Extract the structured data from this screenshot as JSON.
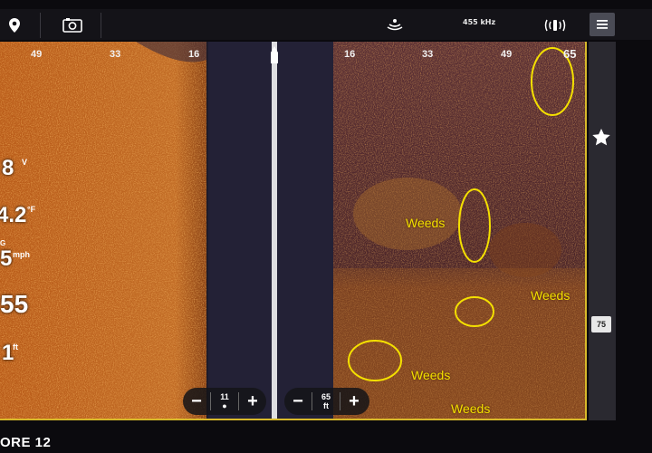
{
  "topbar": {
    "location_icon": "map-pin-icon",
    "camera_icon": "camera-view-icon",
    "sonar_icon": "sonar-beam-icon",
    "frequency": "455 kHz",
    "transducer_icon": "transducer-side-icon",
    "menu_icon": "menu-icon"
  },
  "left_scale": {
    "ticks": [
      "49",
      "33",
      "16"
    ]
  },
  "right_scale": {
    "ticks": [
      "16",
      "33",
      "49",
      "65"
    ]
  },
  "readouts": {
    "voltage": {
      "value": "8",
      "unit": "V"
    },
    "water_temp": {
      "value": "4.2",
      "unit": "°F"
    },
    "speed_label": "G",
    "speed": {
      "value": "5",
      "unit": "mph"
    },
    "time": {
      "value": "55"
    },
    "depth": {
      "value": "1",
      "unit": "ft"
    }
  },
  "zoom_left": {
    "minus": "−",
    "value": "11",
    "plus": "+"
  },
  "zoom_right": {
    "minus": "−",
    "value": "65",
    "unit": "ft",
    "plus": "+"
  },
  "annotations": {
    "labels": [
      "Weeds",
      "Weeds",
      "Weeds",
      "Weeds"
    ],
    "color": "#f4e000"
  },
  "rail": {
    "favorite_icon": "star-icon",
    "depth_marker": "75"
  },
  "brand": {
    "text": "ORE 12"
  },
  "colors": {
    "accent": "#d8b92a",
    "sonar": "#c8742a",
    "annotation": "#f4e000"
  }
}
